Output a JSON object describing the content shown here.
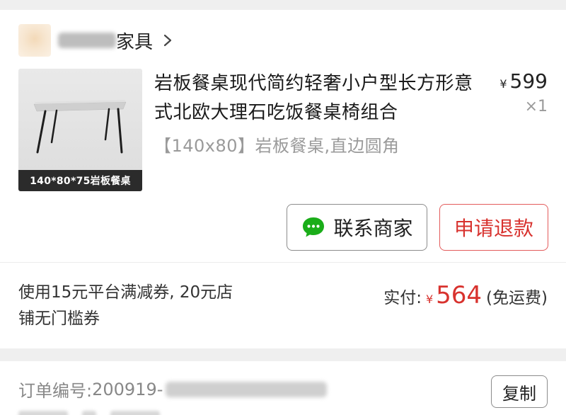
{
  "shop": {
    "name_suffix": "家具"
  },
  "product": {
    "title": "岩板餐桌现代简约轻奢小户型长方形意式北欧大理石吃饭餐桌椅组合",
    "spec": "【140x80】岩板餐桌,直边圆角",
    "thumb_caption": "140*80*75岩板餐桌",
    "price_symbol": "¥",
    "price": "599",
    "quantity": "×1"
  },
  "actions": {
    "contact_label": "联系商家",
    "refund_label": "申请退款"
  },
  "summary": {
    "coupon_text": "使用15元平台满减券, 20元店铺无门槛券",
    "paid_label": "实付:",
    "paid_symbol": "¥",
    "paid_amount": "564",
    "shipping_note": "(免运费)"
  },
  "order": {
    "number_label": "订单编号:",
    "number_prefix": "200919-",
    "copy_label": "复制"
  },
  "colors": {
    "accent": "#d8322e",
    "wechat_green": "#1aad19"
  }
}
